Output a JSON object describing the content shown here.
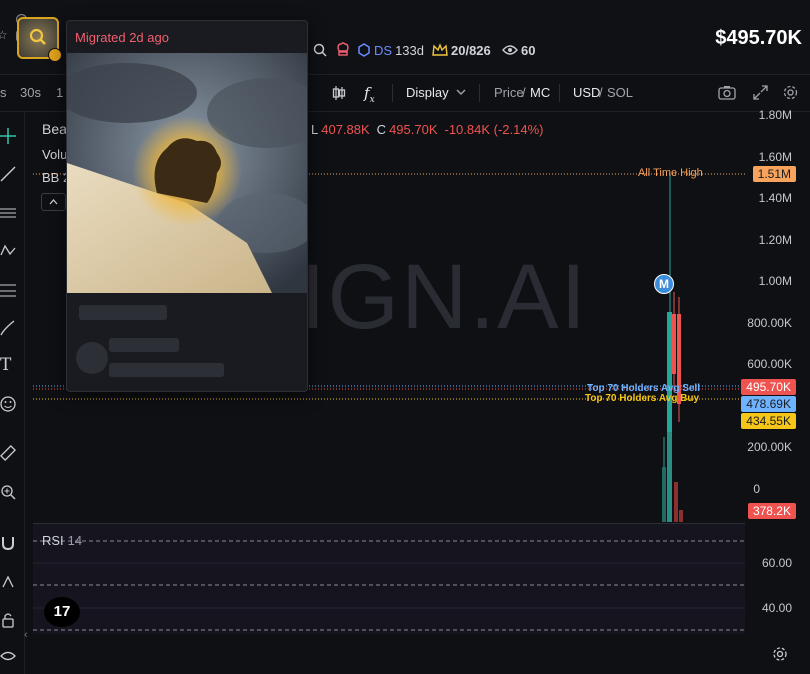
{
  "header": {
    "price": "$495.70K",
    "stats": {
      "ds_label": "DS",
      "ds_age": "133d",
      "holders": "20/826",
      "views": "60"
    }
  },
  "popup": {
    "status": "Migrated 2d ago",
    "image_alt": "bear"
  },
  "toolbar": {
    "intervals": [
      "s",
      "30s",
      "1"
    ],
    "display_label": "Display",
    "price_label": "Price",
    "mc_label": "MC",
    "usd_label": "USD",
    "sol_label": "SOL",
    "fx_label": "f",
    "fx_sub": "x"
  },
  "legend": {
    "name_prefix": "Bea",
    "volume_prefix": "Volu",
    "bb_prefix": "BB 2",
    "low_label": "L",
    "low_value": "407.88K",
    "close_label": "C",
    "close_value": "495.70K",
    "change": "-10.84K (-2.14%)"
  },
  "watermark": "IGN.AI",
  "annotations": {
    "ath_label": "All Time High",
    "top70_sell": "Top 70 Holders Avg Sell",
    "top70_buy": "Top 70 Holders Avg Buy",
    "marker": "M"
  },
  "yaxis": {
    "ticks": [
      "1.80M",
      "1.60M",
      "1.40M",
      "1.20M",
      "1.00M",
      "800.00K",
      "600.00K",
      "200.00K",
      "0"
    ],
    "badges": {
      "ath": "1.51M",
      "last": "495.70K",
      "sell": "478.69K",
      "buy": "434.55K",
      "volume": "378.2K"
    }
  },
  "rsi": {
    "label": "RSI",
    "period": "14",
    "ticks": [
      "60.00",
      "40.00"
    ]
  },
  "tradingview_logo": "17",
  "colors": {
    "up": "#26a69a",
    "down": "#ef5350",
    "ath": "#f7a35c",
    "sell": "#6fb3ff",
    "buy": "#f5c518",
    "accent": "#d9a520"
  }
}
